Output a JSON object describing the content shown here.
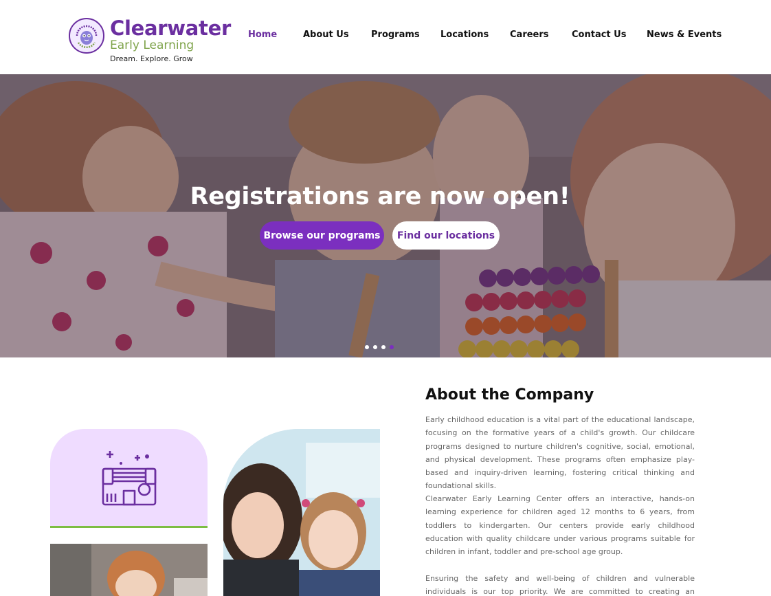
{
  "brand": {
    "name": "Clearwater",
    "sub": "Early Learning",
    "tagline": "Dream. Explore. Grow",
    "badge_text": "CLEARWATER EARLY LEARNING",
    "colors": {
      "purple": "#6b2fa0",
      "green": "#7ea34a"
    }
  },
  "nav": {
    "items": [
      {
        "label": "Home",
        "active": true
      },
      {
        "label": "About Us"
      },
      {
        "label": "Programs"
      },
      {
        "label": "Locations"
      },
      {
        "label": "Careers"
      },
      {
        "label": "Contact Us"
      },
      {
        "label": "News & Events"
      }
    ]
  },
  "hero": {
    "title": "Registrations are now open!",
    "primary_button": "Browse our programs",
    "secondary_button": "Find our locations",
    "slides": 4,
    "active_slide": 4
  },
  "about": {
    "title": "About the Company",
    "paragraphs": [
      "Early childhood education is a vital part of the educational landscape, focusing on the formative years of a child's growth. Our childcare programs designed to nurture children's cognitive, social, emotional, and physical development. These programs often emphasize play-based and inquiry-driven learning, fostering critical thinking and foundational skills.",
      "Clearwater Early Learning Center offers an interactive, hands-on learning experience for children aged 12 months to 6 years, from toddlers to kindergarten. Our centers provide early childhood education with quality childcare under various programs suitable for children in infant, toddler and pre-school age group.",
      "Ensuring the safety and well-being of children and vulnerable individuals is our top priority. We are committed to creating an environment that empowers"
    ]
  }
}
